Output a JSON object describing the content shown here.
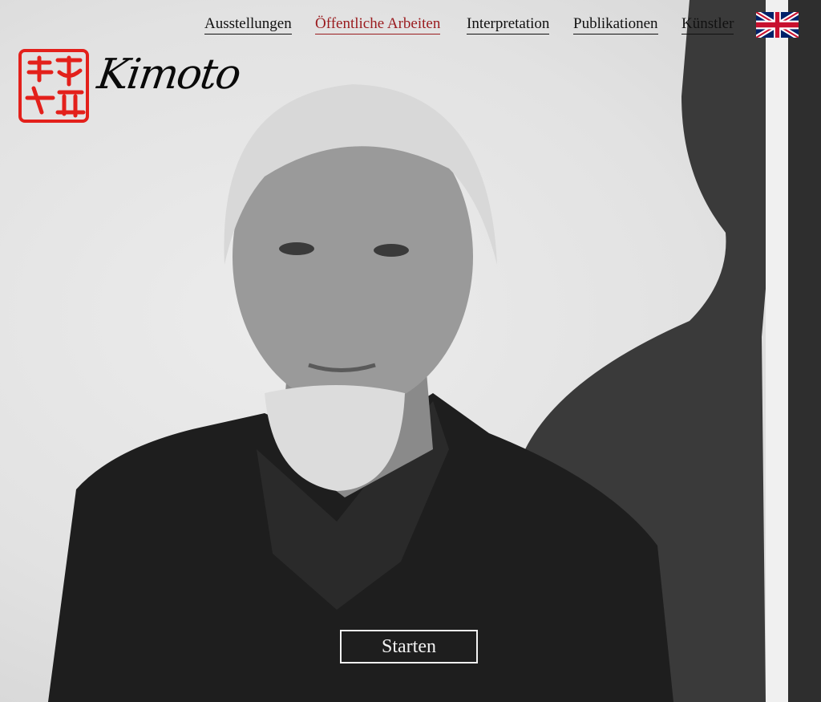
{
  "nav": {
    "items": [
      {
        "label": "Ausstellungen",
        "active": false
      },
      {
        "label": "Öffentliche Arbeiten",
        "active": true
      },
      {
        "label": "Interpretation",
        "active": false
      },
      {
        "label": "Publikationen",
        "active": false
      },
      {
        "label": "Künstler",
        "active": false
      }
    ],
    "language_icon": "uk-flag-icon"
  },
  "logo": {
    "wordmark": "Kimoto",
    "seal_icon": "red-seal-icon"
  },
  "hero": {
    "image": "portrait-photo-icon"
  },
  "cta": {
    "label": "Starten"
  },
  "colors": {
    "active": "#9a1b1e",
    "seal": "#e3201b",
    "text": "#111111"
  }
}
